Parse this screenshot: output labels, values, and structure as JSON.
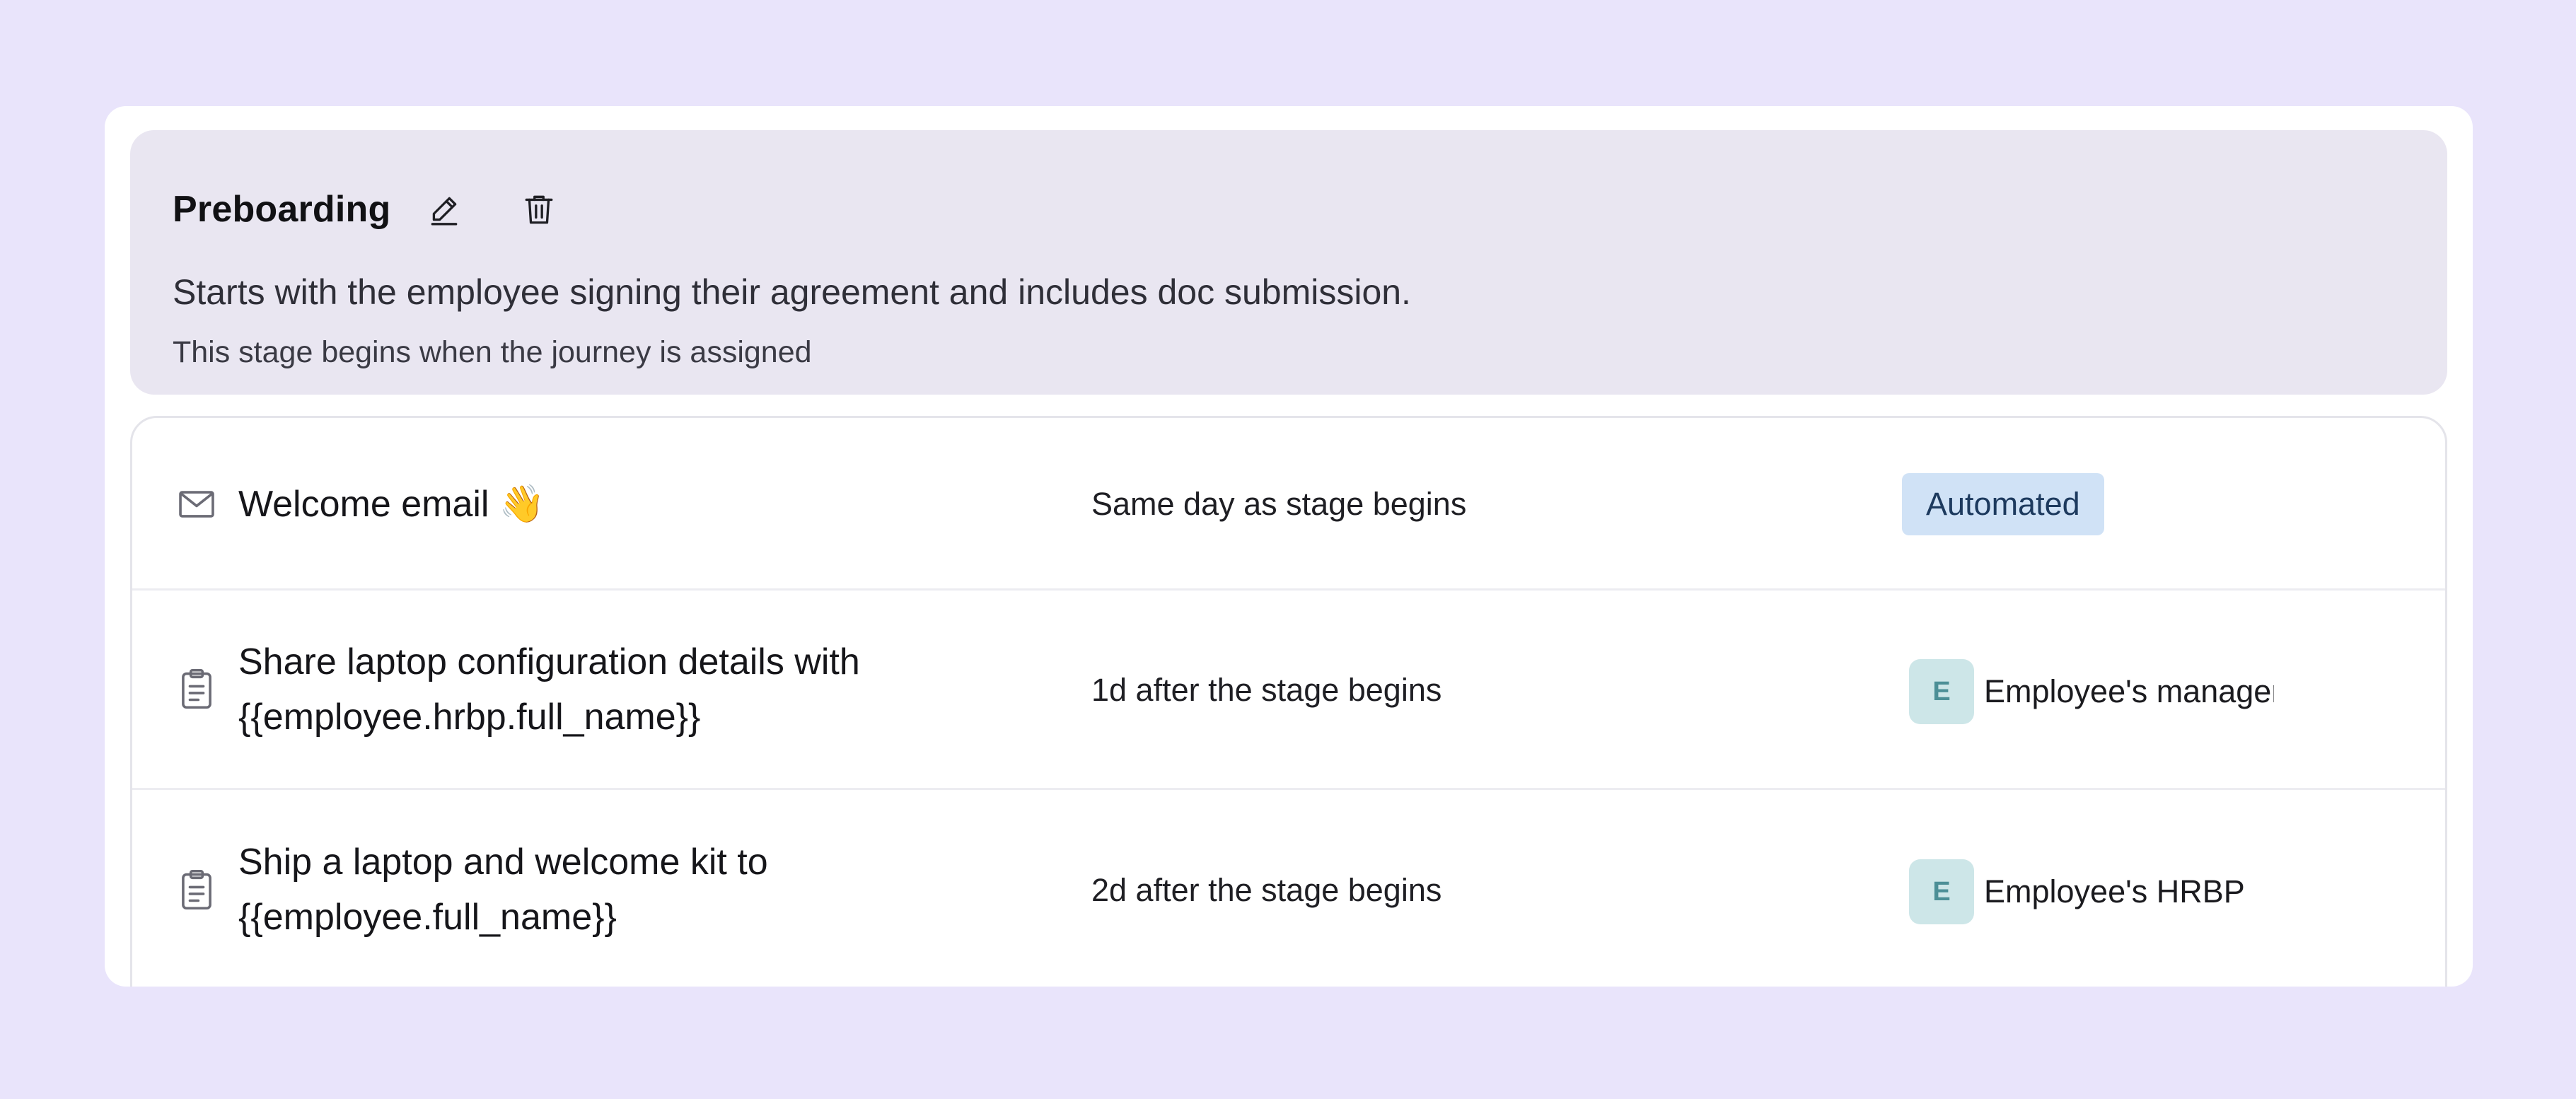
{
  "stage": {
    "title": "Preboarding",
    "description": "Starts with the employee signing their agreement and includes doc submission.",
    "note": "This stage begins when the journey is assigned"
  },
  "tasks": [
    {
      "icon": "mail-icon",
      "title_lines": [
        "Welcome email 👋"
      ],
      "timing": "Same day as stage begins",
      "badge": "Automated"
    },
    {
      "icon": "clipboard-icon",
      "title_lines": [
        "Share laptop configuration details with",
        "{{employee.hrbp.full_name}}"
      ],
      "timing": "1d after the stage begins",
      "assignee": {
        "avatar": "E",
        "name": "Employee's manager"
      }
    },
    {
      "icon": "clipboard-icon",
      "title_lines": [
        "Ship a laptop and welcome kit to",
        "{{employee.full_name}}"
      ],
      "timing": "2d after the stage begins",
      "assignee": {
        "avatar": "E",
        "name": "Employee's HRBP"
      }
    }
  ],
  "colors": {
    "page_background": "#e9e4fb",
    "header_background": "#e9e6f1",
    "badge_background": "#d0e2f6",
    "avatar_background": "#cde6e8"
  }
}
